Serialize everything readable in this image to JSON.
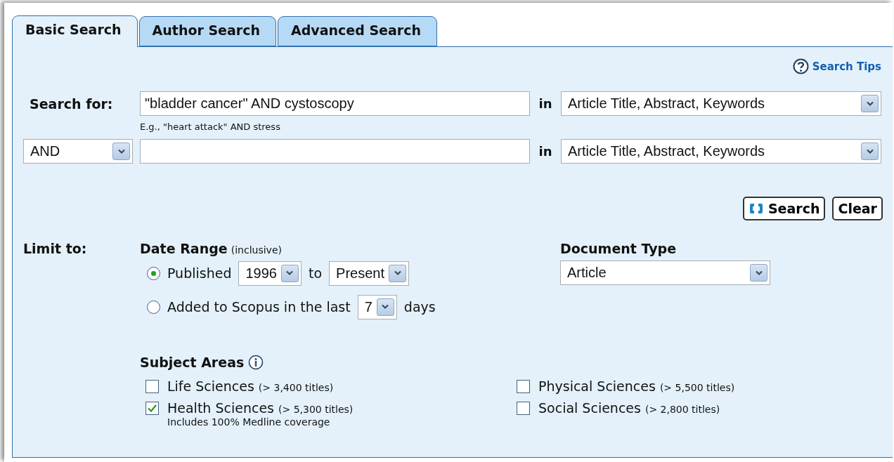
{
  "tabs": [
    {
      "label": "Basic Search",
      "selected": true
    },
    {
      "label": "Author Search",
      "selected": false
    },
    {
      "label": "Advanced Search",
      "selected": false
    }
  ],
  "search_tips": {
    "label": "Search Tips"
  },
  "search_rows": [
    {
      "kind": "label",
      "label": "Search for:",
      "value": "\"bladder cancer\" AND cystoscopy",
      "in_label": "in",
      "field": "Article Title, Abstract, Keywords",
      "hint": "E.g., \"heart attack\" AND stress"
    },
    {
      "kind": "operator",
      "operator": "AND",
      "in_label": "in",
      "field": "Article Title, Abstract, Keywords"
    }
  ],
  "buttons": [
    {
      "kind": "search",
      "label": "Search"
    },
    {
      "kind": "clear",
      "label": "Clear"
    }
  ],
  "limit": {
    "label": "Limit to:",
    "date_range": {
      "title": "Date Range",
      "note": "(inclusive)",
      "options": [
        {
          "kind": "published",
          "selected": true,
          "label": "Published",
          "from": "1996",
          "to_label": "to",
          "to": "Present"
        },
        {
          "kind": "added",
          "selected": false,
          "label": "Added to Scopus in the last",
          "days": "7",
          "suffix": "days"
        }
      ]
    },
    "document_type": {
      "title": "Document Type",
      "value": "Article"
    }
  },
  "subject_areas": {
    "title": "Subject Areas",
    "items": [
      {
        "label": "Life Sciences",
        "count": "(> 3,400 titles)",
        "checked": false
      },
      {
        "label": "Physical Sciences",
        "count": "(> 5,500 titles)",
        "checked": false
      },
      {
        "label": "Health Sciences",
        "count": "(> 5,300 titles)",
        "checked": true,
        "note": "Includes 100% Medline coverage"
      },
      {
        "label": "Social Sciences",
        "count": "(> 2,800 titles)",
        "checked": false
      }
    ]
  }
}
